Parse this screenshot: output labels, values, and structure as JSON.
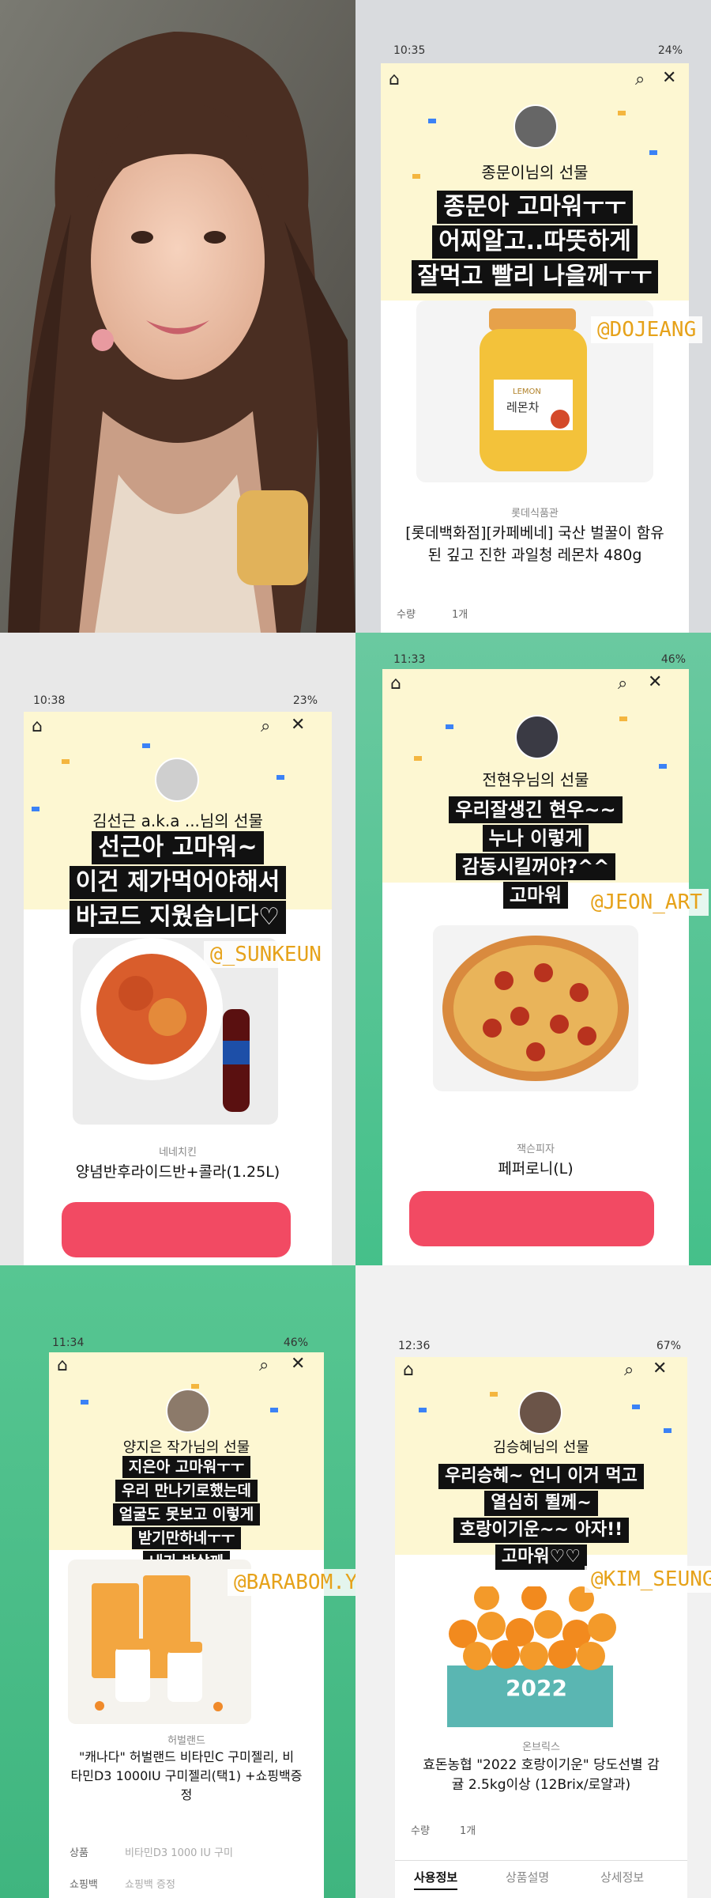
{
  "photo": {
    "alt": ""
  },
  "story1": {
    "time": "10:35",
    "status_right": "24%",
    "sender": "종문이님의 선물",
    "message": [
      "종문아 고마워ㅜㅜ",
      "어찌알고..따뜻하게",
      "잘먹고 빨리 나을께ㅜㅜ"
    ],
    "tag": "@DOJEANG",
    "jar_brand": "LEMON",
    "jar_label": "레몬차",
    "brand": "롯데식품관",
    "product": [
      "[롯데백화점][카페베네] 국산 벌꿀이 함유",
      "된 깊고 진한 과일청 레몬차 480g"
    ],
    "qty_label": "수량",
    "qty_value": "1개"
  },
  "story2": {
    "time": "10:38",
    "status_right": "23%",
    "sender": "김선근 a.k.a ...님의 선물",
    "message": [
      "선근아 고마워~",
      "이건 제가먹어야해서",
      "바코드 지웠습니다♡"
    ],
    "tag": "@_SUNKEUN",
    "brand": "네네치킨",
    "product": [
      "양념반후라이드반+콜라(1.25L)"
    ]
  },
  "story3": {
    "time": "11:33",
    "status_right": "46%",
    "sender": "전현우님의 선물",
    "message": [
      "우리잘생긴 현우~~",
      "누나 이렇게",
      "감동시킬꺼야?^^",
      "고마워"
    ],
    "tag": "@JEON_ART",
    "brand": "잭슨피자",
    "product": [
      "페퍼로니(L)"
    ]
  },
  "story4": {
    "time": "11:34",
    "status_right": "46%",
    "sender": "양지은 작가님의 선물",
    "message": [
      "지은아 고마워ㅜㅜ",
      "우리 만나기로했는데",
      "얼굴도 못보고 이렇게",
      "받기만하네ㅜㅜ",
      "내가 밥살께"
    ],
    "tag": "@BARABOM.Y",
    "brand": "허벌랜드",
    "product": [
      "\"캐나다\" 허벌랜드 비타민C 구미젤리, 비",
      "타민D3 1000IU 구미젤리(택1) +쇼핑백증",
      "정"
    ],
    "info_label1": "상품",
    "info_value1": "비타민D3 1000 IU 구미",
    "info_label2": "쇼핑백",
    "info_value2": "쇼핑백 증정"
  },
  "story5": {
    "time": "12:36",
    "status_right": "67%",
    "sender": "김승혜님의 선물",
    "message": [
      "우리승혜~ 언니 이거 먹고",
      "열심히 뛸께~",
      "호랑이기운~~ 아자!!",
      "고마워♡♡"
    ],
    "tag": "@KIM_SEUNG",
    "box_text": "2022",
    "brand": "온브릭스",
    "product": [
      "효돈농협 \"2022 호랑이기운\" 당도선별 감",
      "귤 2.5kg이상 (12Brix/로얄과)"
    ],
    "qty_label": "수량",
    "qty_value": "1개",
    "tabs": [
      "사용정보",
      "상품설명",
      "상세정보"
    ]
  },
  "colors": {
    "green": "#45c08a",
    "banner": "#fdf7d2",
    "tag": "#e6a21a",
    "redact": "#f24a63"
  }
}
